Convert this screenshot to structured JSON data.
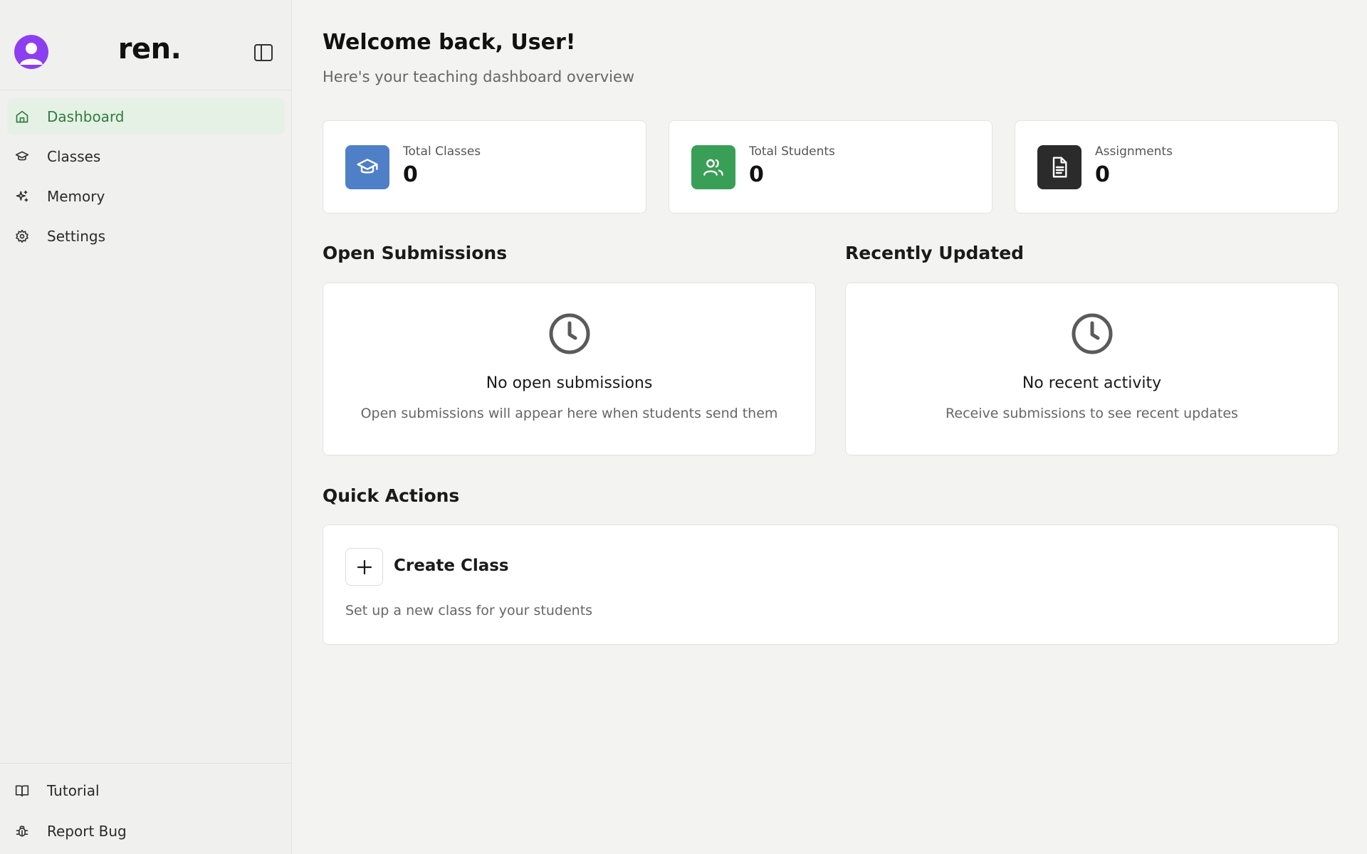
{
  "sidebar": {
    "brand": "ren.",
    "items": [
      {
        "label": "Dashboard",
        "icon": "home-icon",
        "active": true
      },
      {
        "label": "Classes",
        "icon": "graduation-cap-icon"
      },
      {
        "label": "Memory",
        "icon": "sparkles-icon"
      },
      {
        "label": "Settings",
        "icon": "gear-icon"
      }
    ],
    "footer": [
      {
        "label": "Tutorial",
        "icon": "book-open-icon"
      },
      {
        "label": "Report Bug",
        "icon": "bug-icon"
      }
    ]
  },
  "header": {
    "title": "Welcome back, User!",
    "subtitle": "Here's your teaching dashboard overview"
  },
  "stats": [
    {
      "label": "Total Classes",
      "value": "0",
      "icon": "graduation-cap-icon",
      "color": "#4f7fc6"
    },
    {
      "label": "Total Students",
      "value": "0",
      "icon": "users-icon",
      "color": "#3a9f56"
    },
    {
      "label": "Assignments",
      "value": "0",
      "icon": "file-text-icon",
      "color": "#2b2b2b"
    }
  ],
  "open_submissions": {
    "heading": "Open Submissions",
    "empty_title": "No open submissions",
    "empty_desc": "Open submissions will appear here when students send them"
  },
  "recently_updated": {
    "heading": "Recently Updated",
    "empty_title": "No recent activity",
    "empty_desc": "Receive submissions to see recent updates"
  },
  "quick_actions": {
    "heading": "Quick Actions",
    "create_label": "Create Class",
    "create_desc": "Set up a new class for your students"
  },
  "colors": {
    "accent_green": "#2e7d3c",
    "active_bg": "#e6f1e6",
    "avatar": "#8b3ff0"
  }
}
